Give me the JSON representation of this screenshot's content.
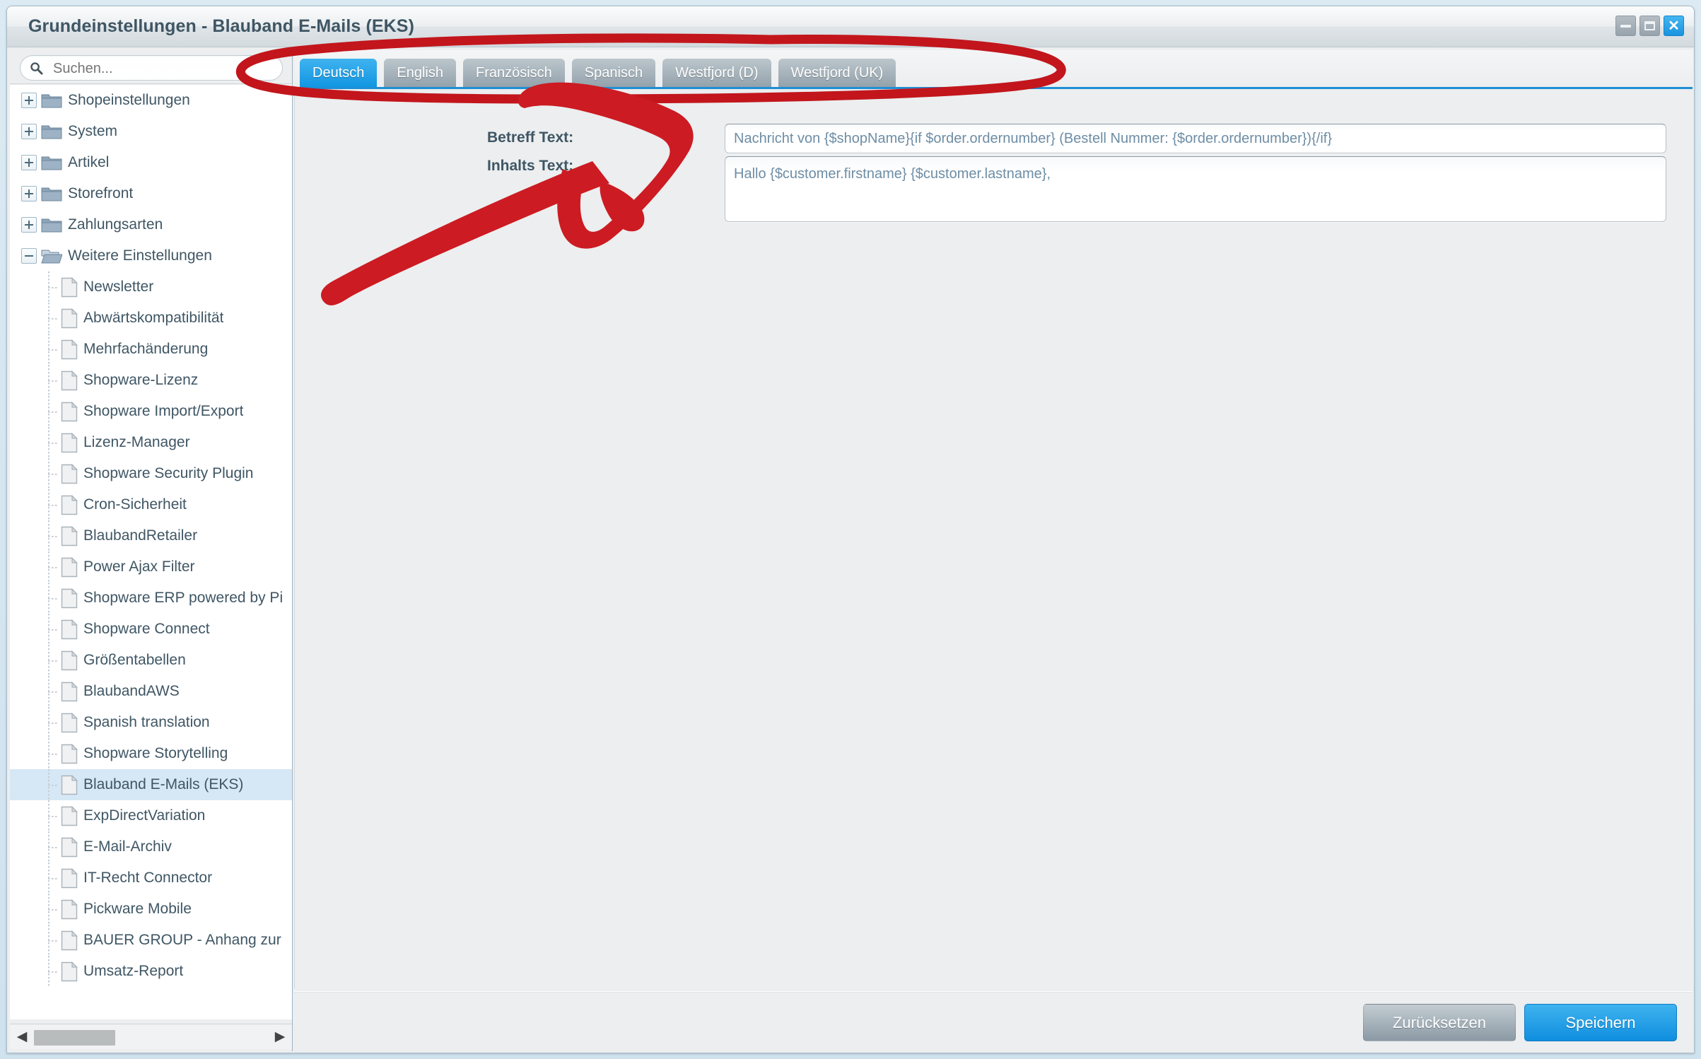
{
  "window": {
    "title": "Grundeinstellungen - Blauband E-Mails (EKS)",
    "controls": {
      "minimize": "minimize-button",
      "maximize": "maximize-button",
      "close": "close-button"
    }
  },
  "sidebar": {
    "search": {
      "placeholder": "Suchen...",
      "value": "",
      "icon": "search-icon"
    },
    "tree": [
      {
        "label": "Shopeinstellungen",
        "type": "folder",
        "expanded": false,
        "depth": 0
      },
      {
        "label": "System",
        "type": "folder",
        "expanded": false,
        "depth": 0
      },
      {
        "label": "Artikel",
        "type": "folder",
        "expanded": false,
        "depth": 0
      },
      {
        "label": "Storefront",
        "type": "folder",
        "expanded": false,
        "depth": 0
      },
      {
        "label": "Zahlungsarten",
        "type": "folder",
        "expanded": false,
        "depth": 0
      },
      {
        "label": "Weitere Einstellungen",
        "type": "folder",
        "expanded": true,
        "depth": 0
      },
      {
        "label": "Newsletter",
        "type": "file",
        "depth": 1
      },
      {
        "label": "Abwärtskompatibilität",
        "type": "file",
        "depth": 1
      },
      {
        "label": "Mehrfachänderung",
        "type": "file",
        "depth": 1
      },
      {
        "label": "Shopware-Lizenz",
        "type": "file",
        "depth": 1
      },
      {
        "label": "Shopware Import/Export",
        "type": "file",
        "depth": 1
      },
      {
        "label": "Lizenz-Manager",
        "type": "file",
        "depth": 1
      },
      {
        "label": "Shopware Security Plugin",
        "type": "file",
        "depth": 1
      },
      {
        "label": "Cron-Sicherheit",
        "type": "file",
        "depth": 1
      },
      {
        "label": "BlaubandRetailer",
        "type": "file",
        "depth": 1
      },
      {
        "label": "Power Ajax Filter",
        "type": "file",
        "depth": 1
      },
      {
        "label": "Shopware ERP powered by Pi",
        "type": "file",
        "depth": 1
      },
      {
        "label": "Shopware Connect",
        "type": "file",
        "depth": 1
      },
      {
        "label": "Größentabellen",
        "type": "file",
        "depth": 1
      },
      {
        "label": "BlaubandAWS",
        "type": "file",
        "depth": 1
      },
      {
        "label": "Spanish translation",
        "type": "file",
        "depth": 1
      },
      {
        "label": "Shopware Storytelling",
        "type": "file",
        "depth": 1
      },
      {
        "label": "Blauband E-Mails (EKS)",
        "type": "file",
        "depth": 1,
        "selected": true
      },
      {
        "label": "ExpDirectVariation",
        "type": "file",
        "depth": 1
      },
      {
        "label": "E-Mail-Archiv",
        "type": "file",
        "depth": 1
      },
      {
        "label": "IT-Recht Connector",
        "type": "file",
        "depth": 1
      },
      {
        "label": "Pickware Mobile",
        "type": "file",
        "depth": 1
      },
      {
        "label": "BAUER GROUP - Anhang zur",
        "type": "file",
        "depth": 1
      },
      {
        "label": "Umsatz-Report",
        "type": "file",
        "depth": 1
      }
    ],
    "hscrollbar": {
      "left_arrow": "◀",
      "right_arrow": "▶"
    }
  },
  "main": {
    "tabs": [
      {
        "label": "Deutsch",
        "active": true
      },
      {
        "label": "English",
        "active": false
      },
      {
        "label": "Französisch",
        "active": false
      },
      {
        "label": "Spanisch",
        "active": false
      },
      {
        "label": "Westfjord (D)",
        "active": false
      },
      {
        "label": "Westfjord (UK)",
        "active": false
      }
    ],
    "fields": [
      {
        "label": "Betreff Text:",
        "value": "Nachricht von {$shopName}{if $order.ordernumber} (Bestell Nummer: {$order.ordernumber}){/if}",
        "placeholder": ""
      },
      {
        "label": "Inhalts Text:",
        "value": "Hallo {$customer.firstname} {$customer.lastname},",
        "placeholder": ""
      }
    ],
    "footer": {
      "reset_label": "Zurücksetzen",
      "save_label": "Speichern"
    }
  },
  "annotations": {
    "ellipse_color": "#c2161c",
    "arrow_color": "#cc1b22",
    "ellipse_target": "language-tabs",
    "arrow_target": "inhalts-text-field"
  },
  "colors": {
    "accent_blue": "#1296e2",
    "tab_inactive": "#93a2ac",
    "text": "#3f5664",
    "field_text": "#6d8da5",
    "selection": "#d6e8f5",
    "annotation_red": "#c2161c"
  }
}
